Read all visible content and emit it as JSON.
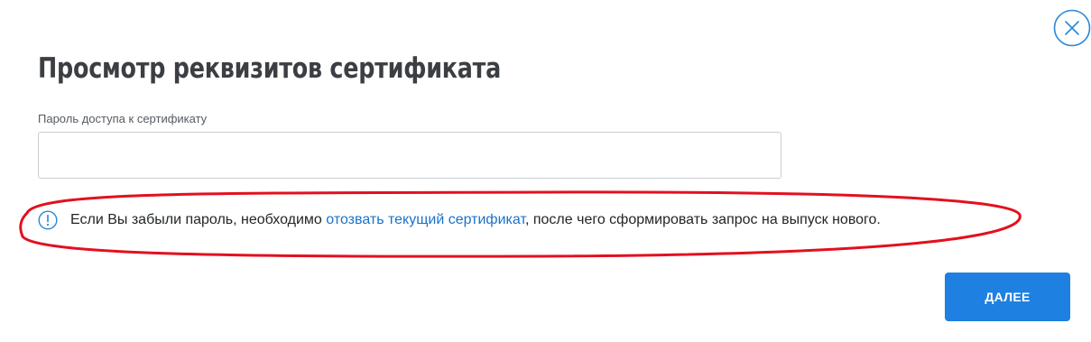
{
  "dialog": {
    "title": "Просмотр реквизитов сертификата",
    "close_icon": "close-icon"
  },
  "password_field": {
    "label": "Пароль доступа к сертификату",
    "value": "",
    "placeholder": ""
  },
  "notice": {
    "icon": "info-icon",
    "text_before": "Если Вы забыли пароль, необходимо ",
    "link_text": "отозвать текущий сертификат",
    "text_after": ", после чего сформировать запрос на выпуск нового."
  },
  "actions": {
    "next_label": "ДАЛЕЕ"
  },
  "colors": {
    "accent": "#1e80e0",
    "link": "#1a73c8",
    "highlight": "#e3101e",
    "title": "#3b3f44"
  }
}
